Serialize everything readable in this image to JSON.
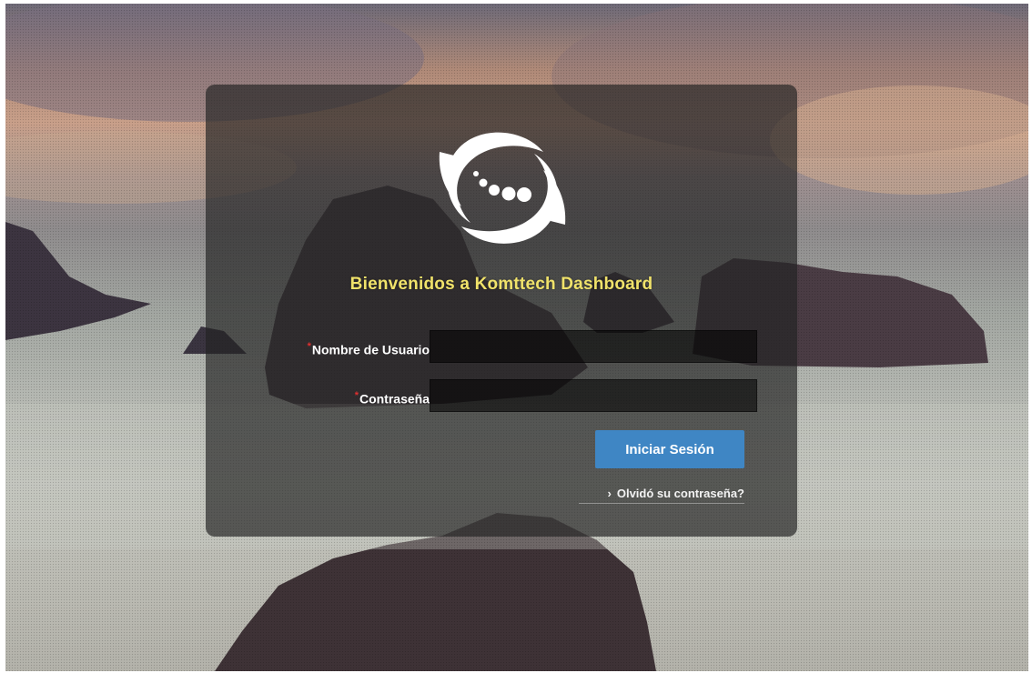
{
  "login": {
    "welcome_title": "Bienvenidos a Komttech Dashboard",
    "username_label": "Nombre de Usuario",
    "password_label": "Contraseña",
    "username_value": "",
    "password_value": "",
    "required_marker": "*",
    "submit_label": "Iniciar Sesión",
    "forgot_chevron": "›",
    "forgot_label": "Olvidó su contraseña?"
  },
  "icons": {
    "logo": "komttech-swirl-logo",
    "forgot_chevron": "chevron-right-icon"
  },
  "colors": {
    "welcome_text": "#f0e26a",
    "primary_button": "#3f86c4",
    "required_marker": "#e03030"
  }
}
